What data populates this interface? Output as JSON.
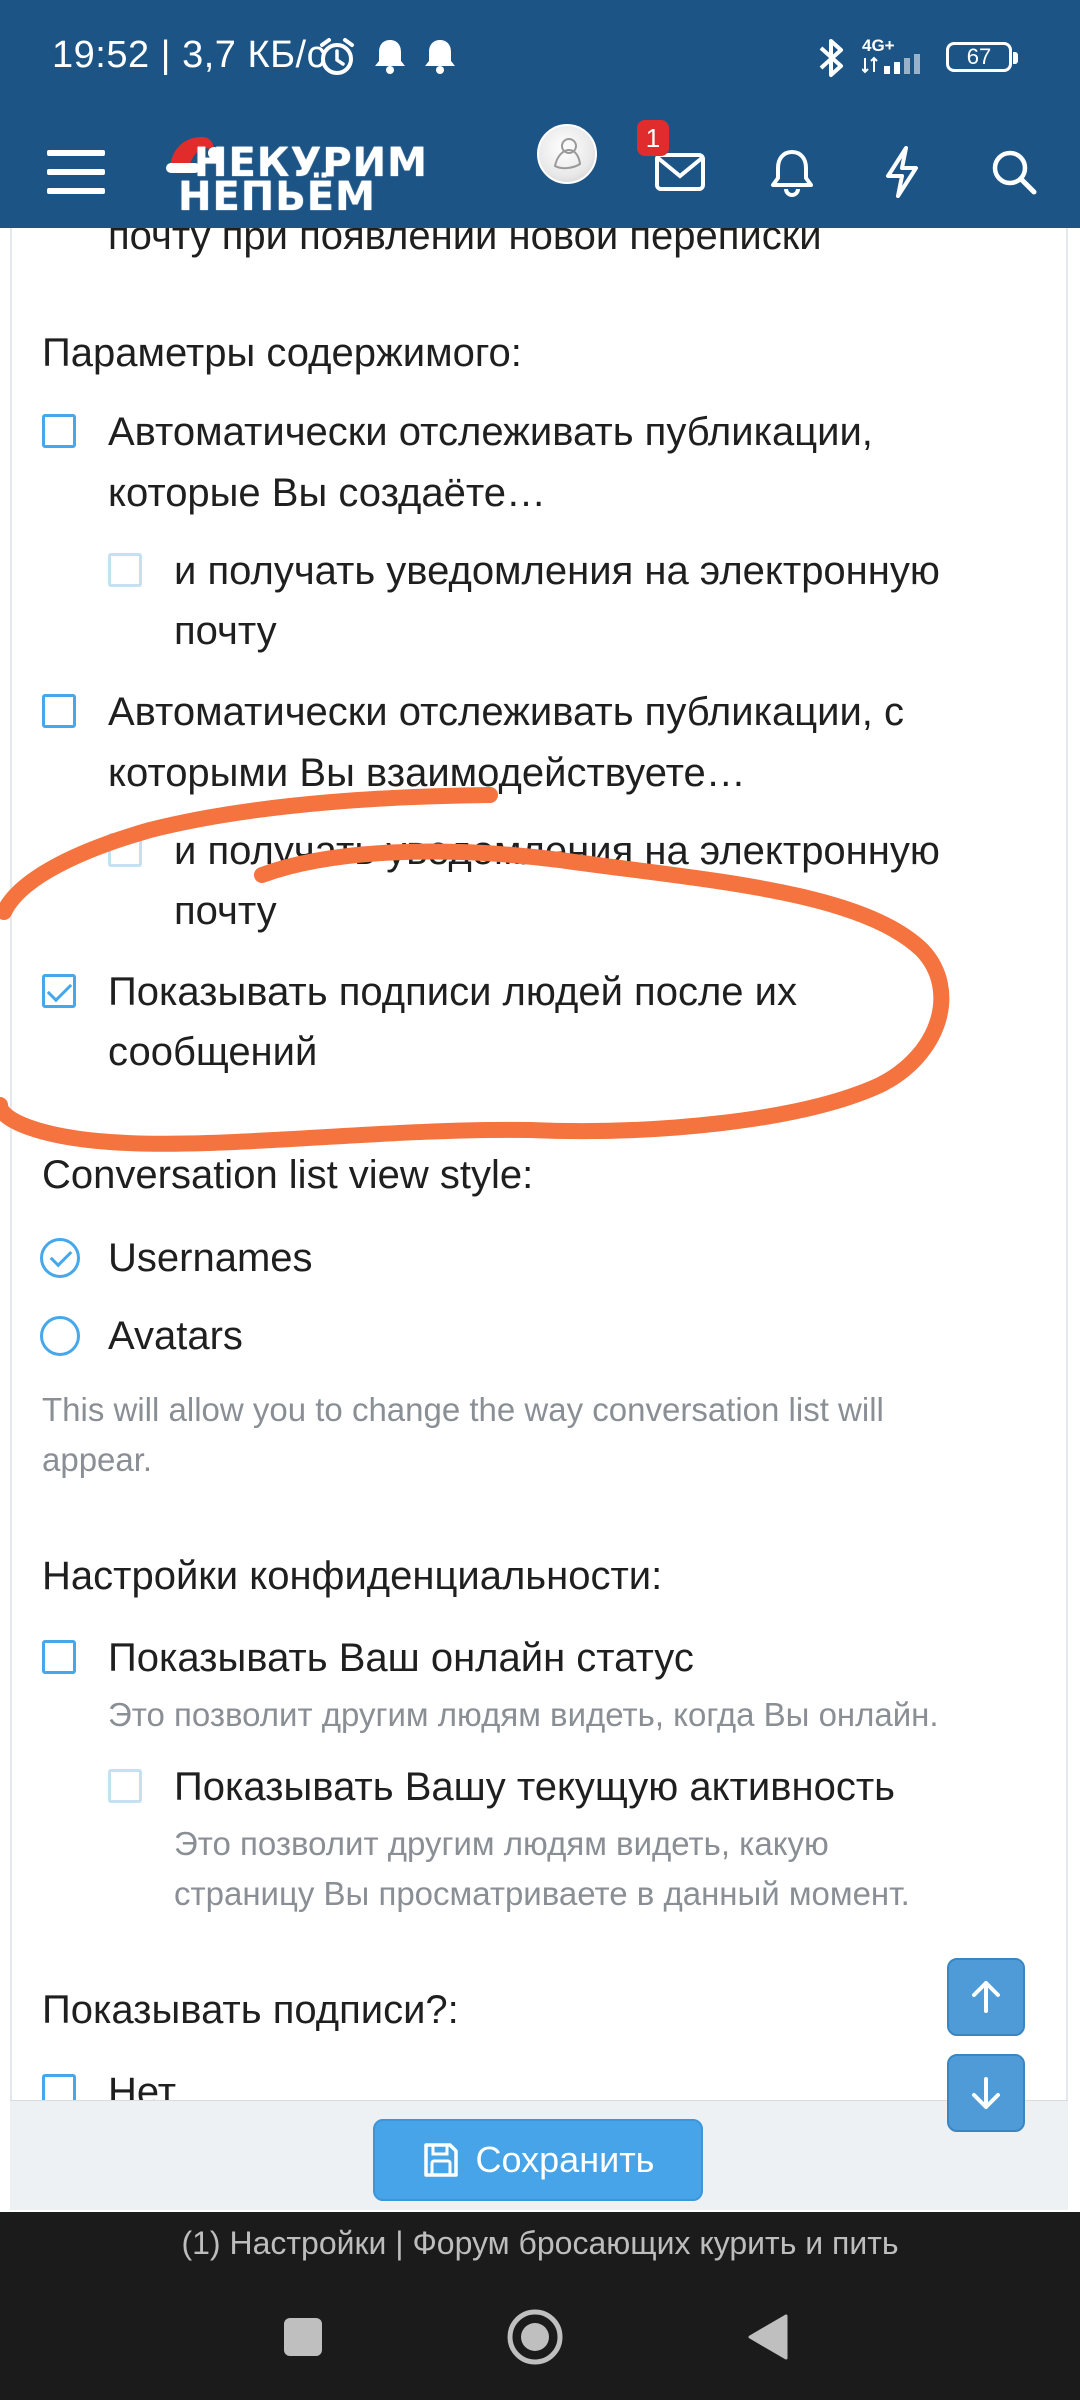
{
  "status_bar": {
    "time": "19:52 | 3,7 КБ/с",
    "network": "4G+",
    "battery": "67",
    "icons": [
      "alarm-icon",
      "bell-icon",
      "bell-icon",
      "bluetooth-icon",
      "signal-icon",
      "battery-icon"
    ]
  },
  "header": {
    "logo_line1": "НЕКУРИМ",
    "logo_line2": "НЕПЬЁМ",
    "inbox_badge": "1",
    "icons": [
      "menu-icon",
      "avatar",
      "mail-icon",
      "bell-icon",
      "lightning-icon",
      "search-icon"
    ]
  },
  "content": {
    "clipped_text": "почту при появлении новой переписки",
    "content_section": {
      "heading": "Параметры содержимого:",
      "watch_created_line1": "Автоматически отслеживать публикации,",
      "watch_created_line2": "которые Вы создаёте…",
      "email_1_line1": "и получать уведомления на электронную",
      "email_1_line2": "почту",
      "watch_interacted_line1": "Автоматически отслеживать публикации, с",
      "watch_interacted_line2": "которыми Вы взаимодействуете…",
      "email_2_line1": "и получать уведомления на электронную",
      "email_2_line2": "почту",
      "show_signatures_line1": "Показывать подписи людей после их",
      "show_signatures_line2": "сообщений"
    },
    "conversation_style": {
      "heading": "Conversation list view style:",
      "option_usernames": "Usernames",
      "option_avatars": "Avatars",
      "selected": "Usernames",
      "hint_line1": "This will allow you to change the way conversation list will",
      "hint_line2": "appear."
    },
    "privacy": {
      "heading": "Настройки конфиденциальности:",
      "online_status": "Показывать Ваш онлайн статус",
      "online_hint": "Это позволит другим людям видеть, когда Вы онлайн.",
      "activity": "Показывать Вашу текущую активность",
      "activity_hint_line1": "Это позволит другим людям видеть, какую",
      "activity_hint_line2": "страницу Вы просматриваете в данный момент."
    },
    "signatures": {
      "heading": "Показывать подписи?:",
      "option_no": "Нет"
    },
    "checkbox_states": {
      "watch_created": false,
      "email_1": false,
      "watch_interacted": false,
      "email_2": false,
      "show_signatures": true,
      "online_status": false,
      "activity": false
    }
  },
  "save_button": {
    "label": "Сохранить"
  },
  "tab_title": "(1) Настройки | Форум бросающих курить и пить",
  "colors": {
    "header_bg": "#1d5486",
    "accent": "#47a7eb",
    "annotation": "#f4733f",
    "badge": "#e02c2c"
  }
}
